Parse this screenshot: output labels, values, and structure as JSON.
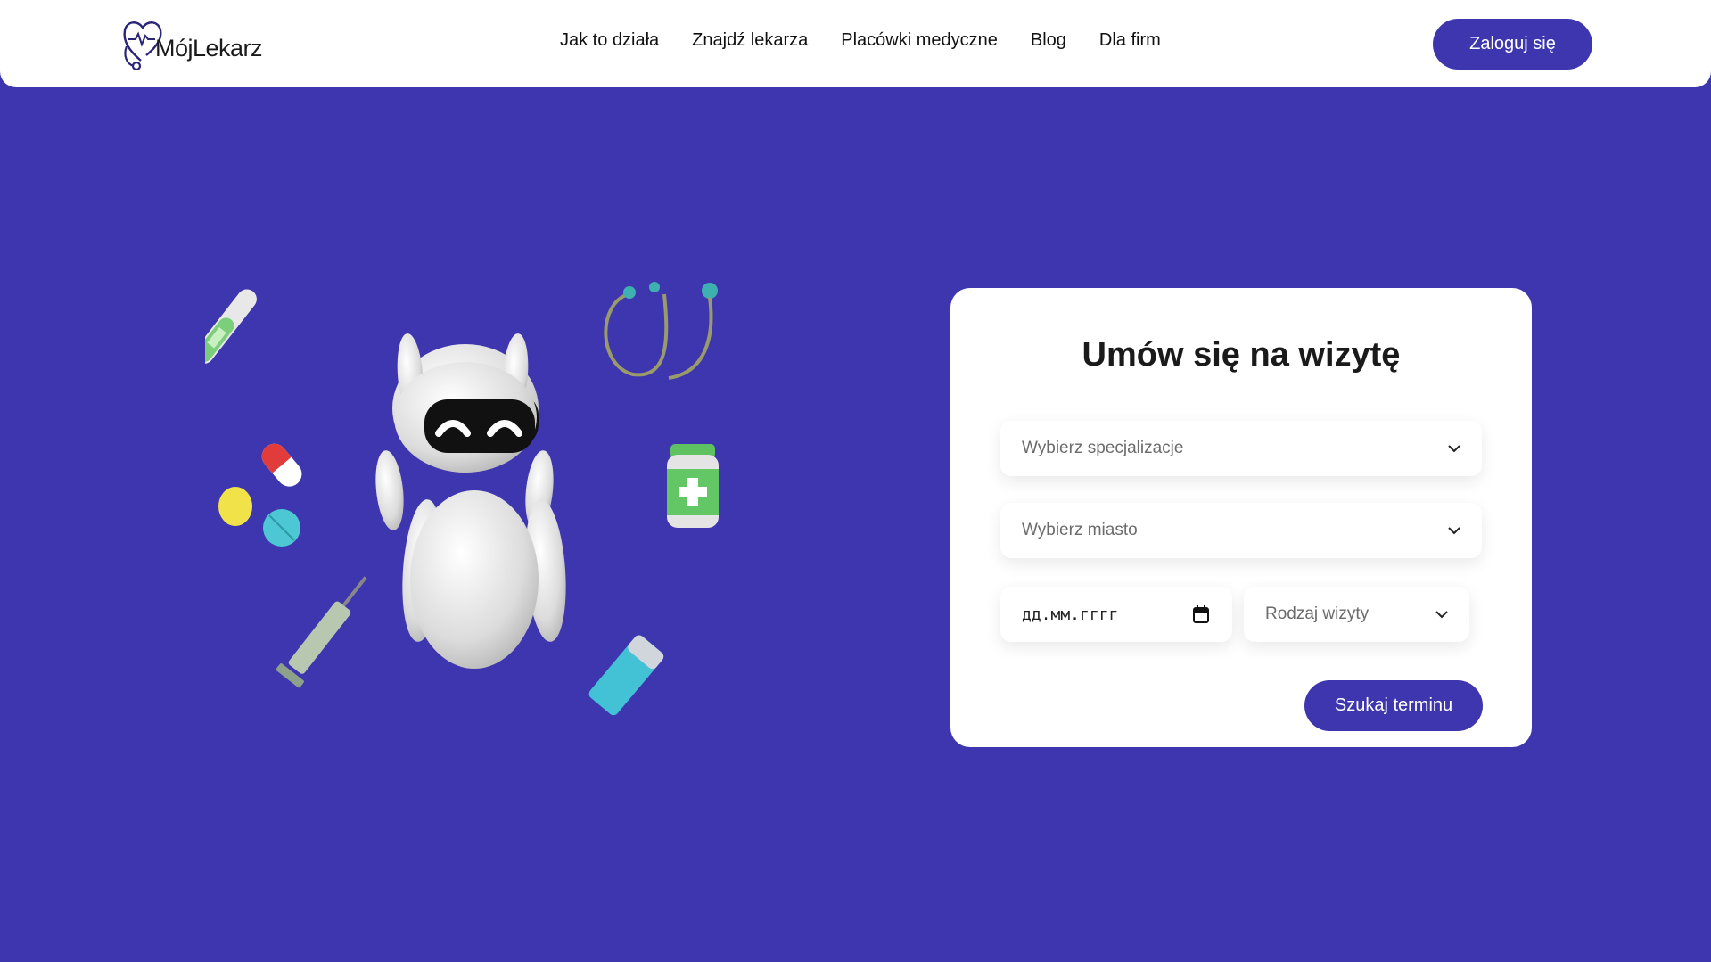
{
  "header": {
    "logo_text": "MójLekarz",
    "nav": [
      "Jak to działa",
      "Znajdź lekarza",
      "Placówki medyczne",
      "Blog",
      "Dla firm"
    ],
    "login_label": "Zaloguj się"
  },
  "booking": {
    "title": "Umów się na wizytę",
    "specialization_placeholder": "Wybierz specjalizacje",
    "city_placeholder": "Wybierz miasto",
    "date_placeholder": "дд.мм.гггг",
    "visit_type_placeholder": "Rodzaj wizyty",
    "search_label": "Szukaj terminu"
  },
  "colors": {
    "brand": "#3e36ae",
    "card": "#ffffff"
  },
  "icons": [
    "heart-stethoscope-logo-icon",
    "chevron-down-icon",
    "calendar-icon",
    "robot-illustration",
    "thermometer-icon",
    "stethoscope-icon",
    "pills-icon",
    "medicine-bottle-icon",
    "syringe-icon",
    "inhaler-icon"
  ]
}
